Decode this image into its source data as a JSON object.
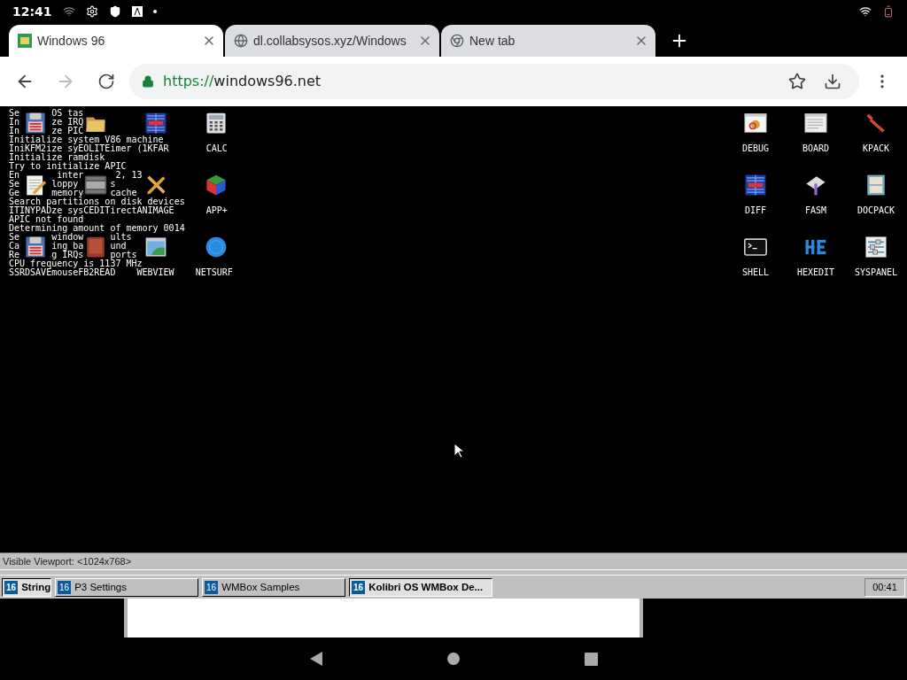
{
  "status_bar": {
    "time": "12:41"
  },
  "tabs": [
    {
      "title": "Windows 96",
      "selected": true
    },
    {
      "title": "dl.collabsysos.xyz/Windows",
      "selected": false
    },
    {
      "title": "New tab",
      "selected": false
    }
  ],
  "address_bar": {
    "scheme": "https://",
    "host": "windows96.net"
  },
  "boot_log": [
    "Se      OS tas",
    "In      ze IRQ",
    "In      ze PIC",
    "Initialize system V86 machine",
    "Ini    ize sy      imer (1",
    "Initialize ramdisk",
    "Try to initialize APIC",
    "En       inter      2, 13",
    "Se      loppy      s",
    "Ge      memory     cache",
    "Search partitions on disk devices",
    "I       ze sys     irect",
    "APIC not found",
    "Determining amount of memory 0014",
    "Se      window     ults",
    "Ca      ing ba     und",
    "Re      g IRQs     ports",
    "CPU frequency is 1137 MHz",
    "S       mouse"
  ],
  "left_icons": [
    {
      "label": "KFM2",
      "kind": "floppy"
    },
    {
      "label": "EOLITE",
      "kind": "folder"
    },
    {
      "label": "KFAR",
      "kind": "panels"
    },
    {
      "label": "CALC",
      "kind": "calculator"
    },
    {
      "label": "TINYPAD",
      "kind": "notepad"
    },
    {
      "label": "CEDIT",
      "kind": "code"
    },
    {
      "label": "ANIMAGE",
      "kind": "tools"
    },
    {
      "label": "APP+",
      "kind": "cube"
    },
    {
      "label": "SRDSAVE",
      "kind": "floppy"
    },
    {
      "label": "FB2READ",
      "kind": "book"
    },
    {
      "label": "WEBVIEW",
      "kind": "window"
    },
    {
      "label": "NETSURF",
      "kind": "globe"
    }
  ],
  "right_icons": [
    {
      "label": "DEBUG",
      "kind": "bug"
    },
    {
      "label": "BOARD",
      "kind": "board"
    },
    {
      "label": "KPACK",
      "kind": "wrench"
    },
    {
      "label": "DIFF",
      "kind": "panels"
    },
    {
      "label": "FASM",
      "kind": "chip"
    },
    {
      "label": "DOCPACK",
      "kind": "cabinet"
    },
    {
      "label": "SHELL",
      "kind": "terminal"
    },
    {
      "label": "HEXEDIT",
      "kind": "hex"
    },
    {
      "label": "SYSPANEL",
      "kind": "sliders"
    }
  ],
  "viewport_status": "Visible Viewport: <1024x768>",
  "taskbar": {
    "items": [
      {
        "badge": "16",
        "title": "String",
        "selected": true
      },
      {
        "badge": "16",
        "title": "P3 Settings",
        "selected": false
      },
      {
        "badge": "16",
        "title": "WMBox Samples",
        "selected": false
      },
      {
        "badge": "16",
        "title": "Kolibri OS WMBox De...",
        "selected": true
      }
    ],
    "clock": "00:41"
  }
}
